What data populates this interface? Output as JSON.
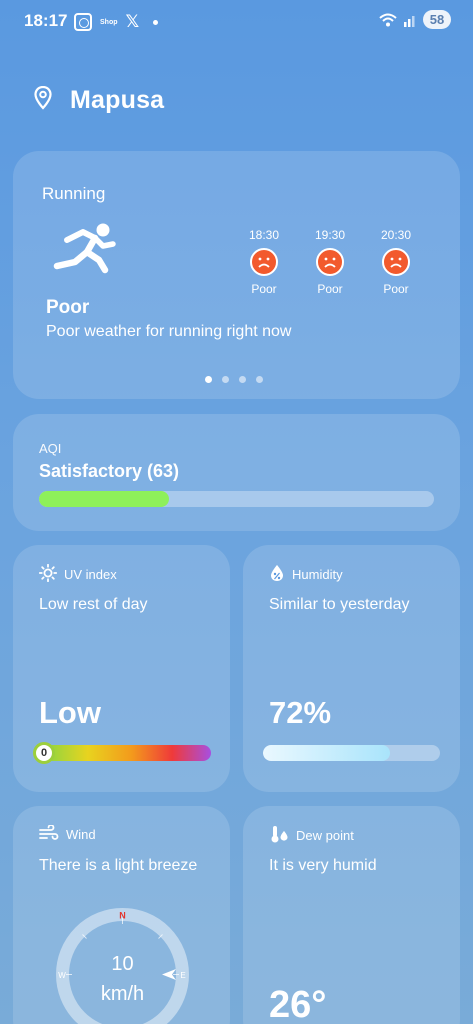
{
  "status_bar": {
    "time": "18:17",
    "shop_label": "Shop",
    "x_icon": "𝕏",
    "battery": "58"
  },
  "header": {
    "location": "Mapusa"
  },
  "running": {
    "title": "Running",
    "rating": "Poor",
    "description": "Poor weather for running right now",
    "forecast": [
      {
        "time": "18:30",
        "rating": "Poor"
      },
      {
        "time": "19:30",
        "rating": "Poor"
      },
      {
        "time": "20:30",
        "rating": "Poor"
      }
    ],
    "pager_active_index": 0,
    "pager_count": 4
  },
  "aqi": {
    "label": "AQI",
    "value": "Satisfactory (63)",
    "level_fraction": 0.33,
    "bar_color": "#8ef05a"
  },
  "uv": {
    "label": "UV index",
    "description": "Low rest of day",
    "value": "Low",
    "knob_value": "0"
  },
  "humidity": {
    "label": "Humidity",
    "description": "Similar to yesterday",
    "value": "72%",
    "level_fraction": 0.72
  },
  "wind": {
    "label": "Wind",
    "description": "There is a light breeze",
    "speed": "10",
    "unit": "km/h",
    "directions": {
      "n": "N",
      "e": "E",
      "w": "W"
    }
  },
  "dew_point": {
    "label": "Dew point",
    "description": "It is very humid",
    "value": "26°"
  }
}
